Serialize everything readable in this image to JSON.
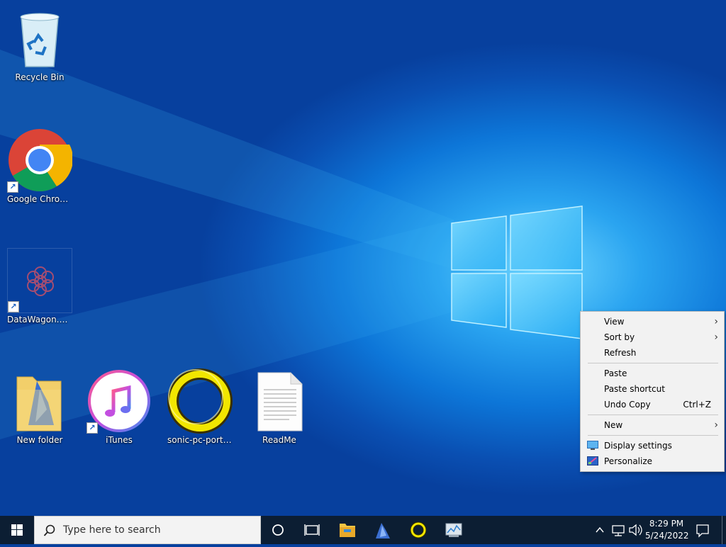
{
  "desktop": {
    "icons": [
      {
        "label": "Recycle Bin"
      },
      {
        "label": "Google Chrome"
      },
      {
        "label": "DataWagon.com"
      },
      {
        "label": "New folder"
      },
      {
        "label": "iTunes"
      },
      {
        "label": "sonic-pc-port-re..."
      },
      {
        "label": "ReadMe"
      }
    ]
  },
  "context_menu": {
    "items": [
      {
        "label": "View",
        "submenu": true
      },
      {
        "label": "Sort by",
        "submenu": true
      },
      {
        "label": "Refresh"
      },
      {
        "label": "Paste"
      },
      {
        "label": "Paste shortcut"
      },
      {
        "label": "Undo Copy",
        "shortcut": "Ctrl+Z"
      },
      {
        "label": "New",
        "submenu": true
      },
      {
        "label": "Display settings",
        "icon": "display-icon"
      },
      {
        "label": "Personalize",
        "icon": "personalize-icon"
      }
    ]
  },
  "taskbar": {
    "search_placeholder": "Type here to search",
    "clock": {
      "time": "8:29 PM",
      "date": "5/24/2022"
    }
  }
}
